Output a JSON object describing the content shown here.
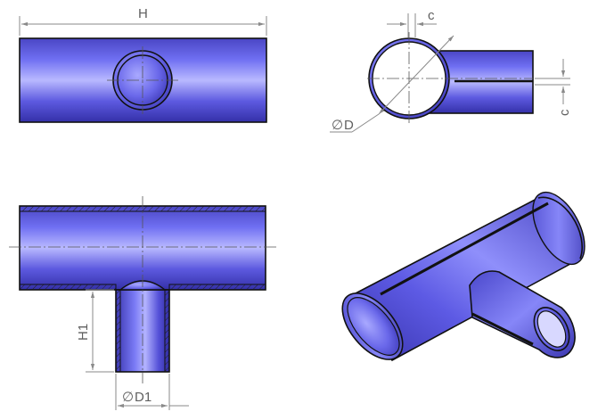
{
  "drawing": {
    "title": "",
    "labels": {
      "length": "H",
      "weld_offset_top": "c",
      "weld_offset_side": "c",
      "main_diameter": "D",
      "branch_height": "H1",
      "branch_diameter": "D1"
    },
    "diameter_symbol": "∅",
    "colors": {
      "pipe_dark": "#3b37b8",
      "pipe_mid": "#6b6bf0",
      "pipe_light": "#b8b8ff",
      "edge": "#111111",
      "dimension": "#8a8a8a",
      "text": "#5f5f5f",
      "background": "#ffffff"
    }
  }
}
